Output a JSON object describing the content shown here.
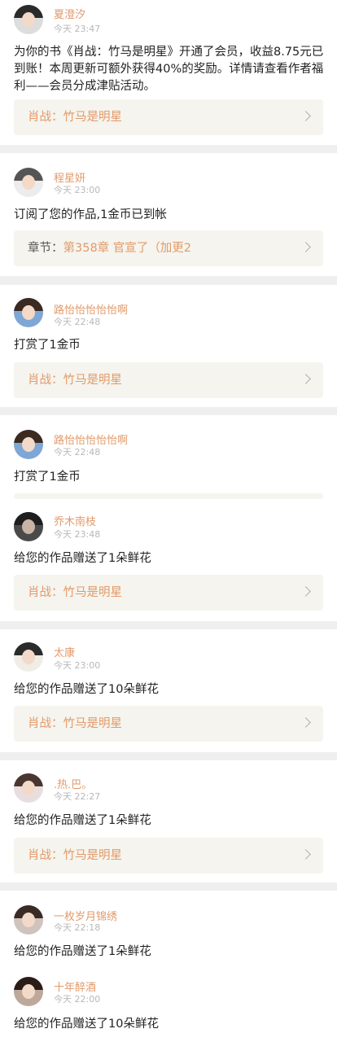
{
  "items": [
    {
      "user": "夏澄汐",
      "time": "今天 23:47",
      "message": "为你的书《肖战：竹马是明星》开通了会员，收益8.75元已到账！本周更新可额外获得40%的奖励。详情请查看作者福利——会员分成津贴活动。",
      "link": "肖战：竹马是明星"
    },
    {
      "user": "程星妍",
      "time": "今天 23:00",
      "message": "订阅了您的作品,1金币已到帐",
      "link_prefix": "章节：",
      "link": "第358章 官宣了（加更2"
    },
    {
      "user": "路怡怡怡怡怡啊",
      "time": "今天 22:48",
      "message": "打赏了1金币",
      "link": "肖战：竹马是明星"
    },
    {
      "user": "路怡怡怡怡怡啊",
      "time": "今天 22:48",
      "message": "打赏了1金币"
    },
    {
      "user": "乔木南枝",
      "time": "今天 23:48",
      "message": "给您的作品赠送了1朵鲜花",
      "link": "肖战：竹马是明星"
    },
    {
      "user": "太康",
      "time": "今天 23:00",
      "message": "给您的作品赠送了10朵鲜花",
      "link": "肖战：竹马是明星"
    },
    {
      "user": ".热.巴。",
      "time": "今天 22:27",
      "message": "给您的作品赠送了1朵鲜花",
      "link": "肖战：竹马是明星"
    },
    {
      "user": "一枚岁月锦绣",
      "time": "今天 22:18",
      "message": "给您的作品赠送了1朵鲜花"
    },
    {
      "user": "十年醉酒",
      "time": "今天 22:00",
      "message": "给您的作品赠送了10朵鲜花"
    }
  ]
}
